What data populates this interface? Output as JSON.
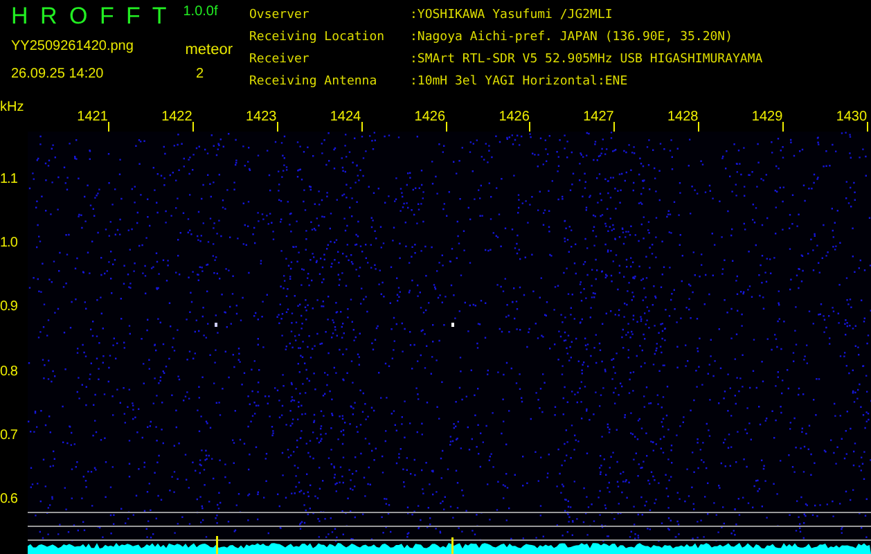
{
  "app": {
    "title": "H R O F F T",
    "version": "1.0.0f",
    "filename": "YY2509261420.png",
    "datetime": "26.09.25 14:20",
    "event_label": "meteor",
    "event_count": "2"
  },
  "info": [
    {
      "label": "Ovserver",
      "value": ":YOSHIKAWA Yasufumi /JG2MLI"
    },
    {
      "label": "Receiving Location",
      "value": ":Nagoya Aichi-pref. JAPAN (136.90E, 35.20N)"
    },
    {
      "label": "Receiver",
      "value": ":SMArt RTL-SDR V5 52.905MHz USB HIGASHIMURAYAMA"
    },
    {
      "label": "Receiving Antenna",
      "value": ":10mH 3el YAGI Horizontal:ENE"
    }
  ],
  "x_axis": {
    "unit": "kHz",
    "labels": [
      "1421",
      "1422",
      "1423",
      "1424",
      "1426",
      "1426",
      "1427",
      "1428",
      "1429",
      "1430"
    ]
  },
  "y_axis": {
    "labels": [
      "1.1",
      "1.0",
      "0.9",
      "0.8",
      "0.7",
      "0.6"
    ]
  }
}
